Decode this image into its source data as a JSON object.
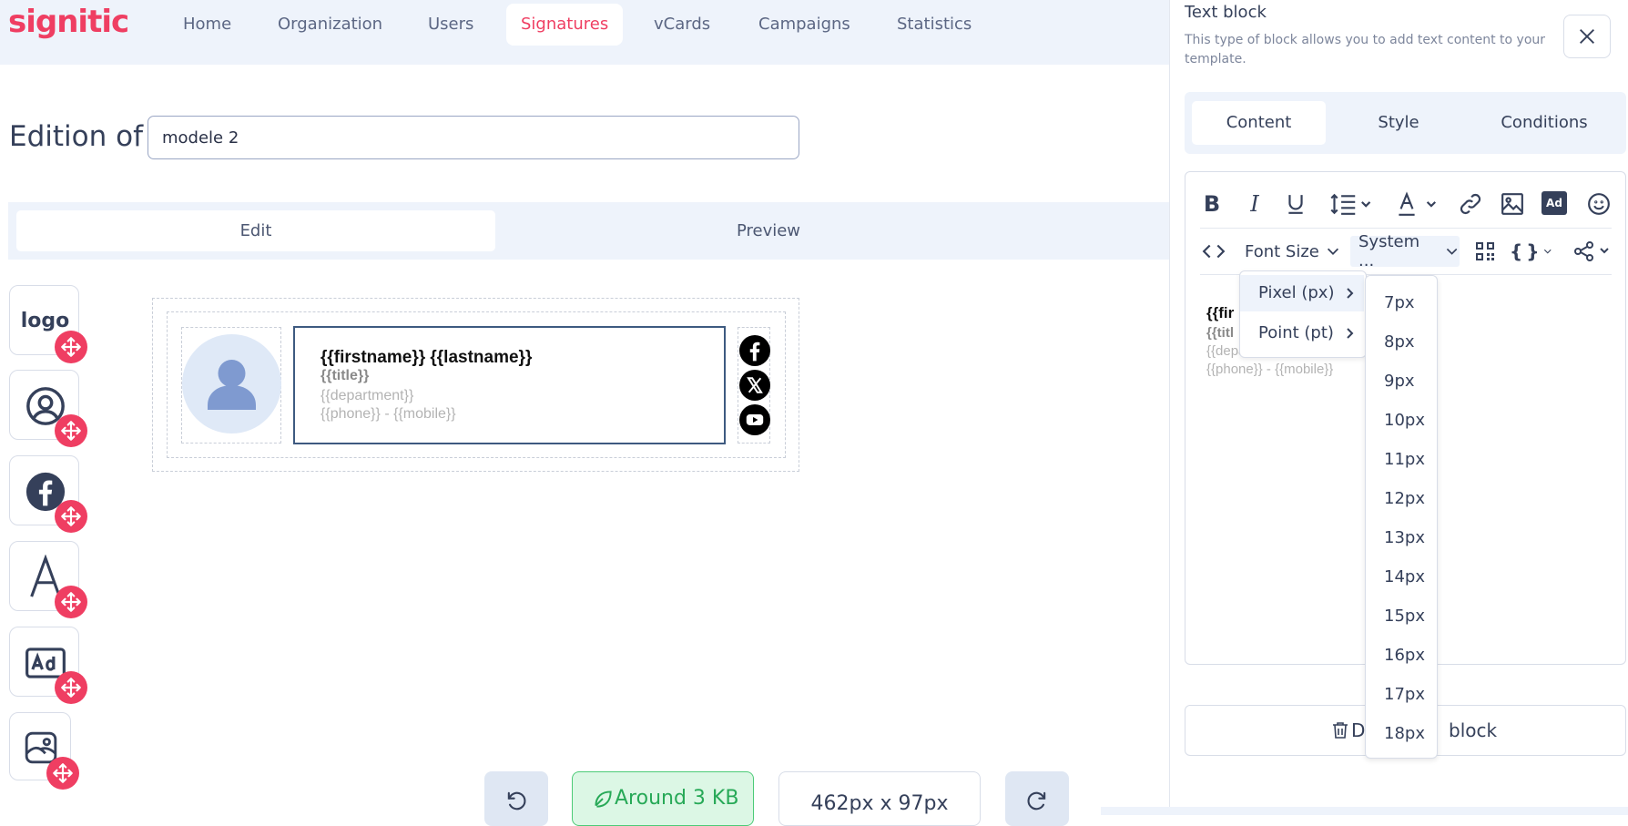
{
  "brand": {
    "logo_text": "signitic",
    "accent": "#ef3e62"
  },
  "nav": {
    "items": [
      {
        "label": "Home"
      },
      {
        "label": "Organization"
      },
      {
        "label": "Users"
      },
      {
        "label": "Signatures",
        "active": true
      },
      {
        "label": "vCards"
      },
      {
        "label": "Campaigns"
      },
      {
        "label": "Statistics"
      }
    ]
  },
  "editor": {
    "edition_label": "Edition of",
    "template_name": "modele 2",
    "tabs": {
      "edit": "Edit",
      "preview": "Preview"
    }
  },
  "palette": {
    "items": [
      {
        "label": "logo",
        "icon": "logo-text"
      },
      {
        "icon": "user-circle-icon"
      },
      {
        "icon": "facebook-icon"
      },
      {
        "icon": "text-icon"
      },
      {
        "icon": "ad-icon"
      },
      {
        "icon": "image-icon"
      }
    ],
    "drag_icon": "move-icon"
  },
  "signature": {
    "name_line": "{{firstname}} {{lastname}}",
    "title_line": "{{title}}",
    "department_line": "{{department}}",
    "phone_line": "{{phone}} - {{mobile}}",
    "social_icons": [
      "facebook-icon",
      "x-icon",
      "youtube-icon"
    ]
  },
  "footer": {
    "size_estimate": "Around 3 KB",
    "dimensions": "462px x 97px",
    "undo_icon": "undo-icon",
    "redo_icon": "redo-icon"
  },
  "panel": {
    "title": "Text block",
    "description": "This type of block allows you to add text content to your template.",
    "tabs": {
      "content": "Content",
      "style": "Style",
      "conditions": "Conditions"
    },
    "toolbar": {
      "font_size_label": "Font Size",
      "font_family_label": "System ..."
    },
    "preview_text": {
      "name": "{{fir",
      "title": "{{titl",
      "department": "{{department}}",
      "phone": "{{phone}} - {{mobile}}"
    },
    "delete_label_a": "De",
    "delete_label_b": "block"
  },
  "font_size_menu": {
    "units": [
      {
        "label": "Pixel (px)"
      },
      {
        "label": "Point (pt)"
      }
    ],
    "sizes": [
      "7px",
      "8px",
      "9px",
      "10px",
      "11px",
      "12px",
      "13px",
      "14px",
      "15px",
      "16px",
      "17px",
      "18px"
    ]
  }
}
